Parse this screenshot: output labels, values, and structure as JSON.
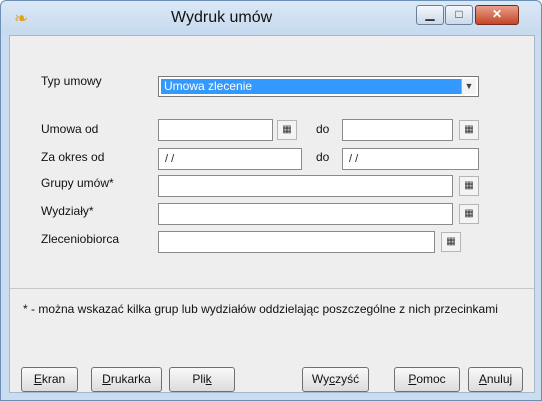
{
  "window": {
    "title": "Wydruk umów",
    "icon": "app-icon",
    "controls": [
      "minimize",
      "maximize",
      "close"
    ]
  },
  "form": {
    "type_label": "Typ umowy",
    "type_value": "Umowa zlecenie",
    "umowa_od_label": "Umowa od",
    "do_label_1": "do",
    "za_okres_label": "Za okres od",
    "za_okres_from": "/ /",
    "do_label_2": "do",
    "za_okres_to": "/ /",
    "grupy_label": "Grupy umów*",
    "wydzialy_label": "Wydziały*",
    "zleceniobiorca_label": "Zleceniobiorca"
  },
  "note": "* - można wskazać kilka grup lub wydziałów oddzielając poszczególne z nich przecinkami",
  "buttons": {
    "ekran_u": "E",
    "ekran_rest": "kran",
    "drukarka_u": "D",
    "drukarka_rest": "rukarka",
    "plik_pre": "Pli",
    "plik_u": "k",
    "wyczysc_pre": "Wy",
    "wyczysc_u": "c",
    "wyczysc_rest": "zyść",
    "pomoc_u": "P",
    "pomoc_rest": "omoc",
    "anuluj_u": "A",
    "anuluj_rest": "nuluj"
  }
}
